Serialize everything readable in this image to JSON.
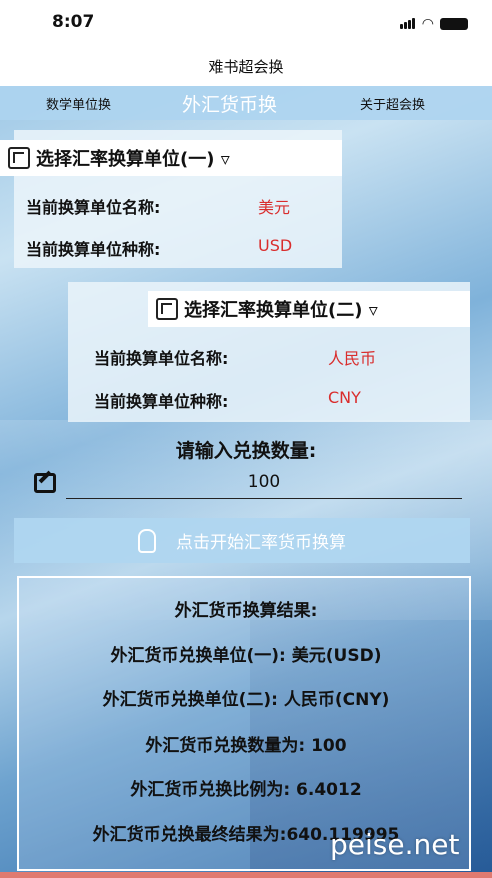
{
  "status": {
    "time": "8:07"
  },
  "nav": {
    "title": "难书超会换"
  },
  "tabs": [
    {
      "label": "数学单位换"
    },
    {
      "label": "外汇货币换"
    },
    {
      "label": "关于超会换"
    }
  ],
  "unit1": {
    "selector_label": "选择汇率换算单位(一) ▿",
    "name_label": "当前换算单位名称:",
    "name_value": "美元",
    "code_label": "当前换算单位种称:",
    "code_value": "USD"
  },
  "unit2": {
    "selector_label": "选择汇率换算单位(二) ▿",
    "name_label": "当前换算单位名称:",
    "name_value": "人民币",
    "code_label": "当前换算单位种称:",
    "code_value": "CNY"
  },
  "input": {
    "prompt": "请输入兑换数量:",
    "value": "100"
  },
  "convert_button": {
    "label": "点击开始汇率货币换算"
  },
  "result": {
    "title": "外汇货币换算结果:",
    "unit1": "外汇货币兑换单位(一): 美元(USD)",
    "unit2": "外汇货币兑换单位(二): 人民币(CNY)",
    "amount": "外汇货币兑换数量为: 100",
    "rate": "外汇货币兑换比例为: 6.4012",
    "final": "外汇货币兑换最终结果为:640.119995"
  },
  "watermark": "peise.net"
}
